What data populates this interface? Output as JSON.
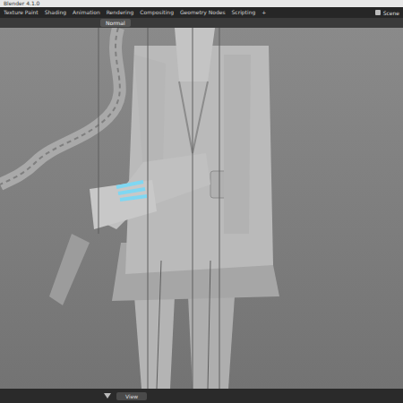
{
  "window": {
    "title": "Blender 4.1.0"
  },
  "workspace_tabs": [
    {
      "label": "Texture Paint",
      "selected": false
    },
    {
      "label": "Shading",
      "selected": false
    },
    {
      "label": "Animation",
      "selected": false
    },
    {
      "label": "Rendering",
      "selected": false
    },
    {
      "label": "Compositing",
      "selected": false
    },
    {
      "label": "Geometry Nodes",
      "selected": false
    },
    {
      "label": "Scripting",
      "selected": false
    },
    {
      "label": "+",
      "selected": false
    }
  ],
  "scene": {
    "label": "Scene"
  },
  "header": {
    "orientation": "Normal"
  },
  "footer": {
    "field": "View"
  }
}
